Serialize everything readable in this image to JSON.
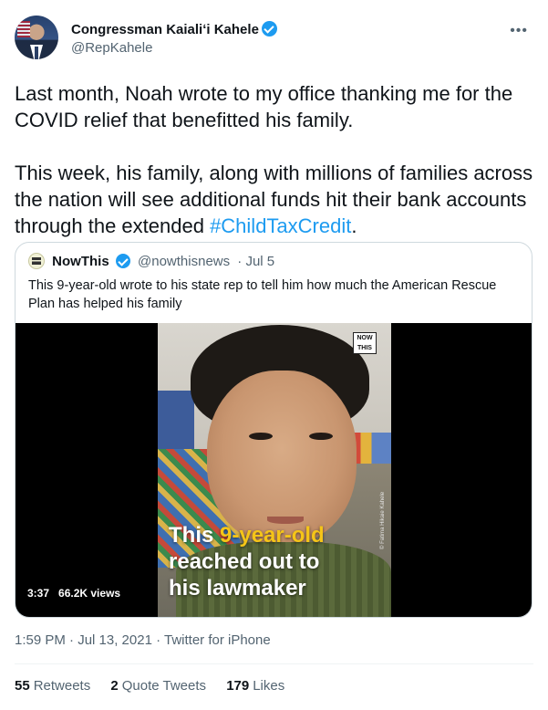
{
  "author": {
    "name": "Congressman Kaialiʻi Kahele",
    "handle": "@RepKahele",
    "verified": true
  },
  "tweet": {
    "paragraph1": "Last month, Noah wrote to my office thanking me for the COVID relief that benefitted his family.",
    "paragraph2_before": "This week, his family, along with millions of families across the nation will see additional funds hit their bank accounts through the extended ",
    "hashtag": "#ChildTaxCredit",
    "paragraph2_after": "."
  },
  "quote": {
    "name": "NowThis",
    "handle": "@nowthisnews",
    "date": "· Jul 5",
    "text": "This 9-year-old wrote to his state rep to tell him how much the American Rescue Plan has helped his family",
    "video": {
      "badge_line1": "NOW",
      "badge_line2": "THIS",
      "caption_white1": "This ",
      "caption_yellow": "9-year-old",
      "caption_line2": "reached out to",
      "caption_line3": "his lawmaker",
      "credit": "© Fatima Hikaie Kahele",
      "duration": "3:37",
      "views": "66.2K views"
    }
  },
  "meta": {
    "timestamp": "1:59 PM · Jul 13, 2021 · Twitter for iPhone"
  },
  "stats": {
    "retweets": "55",
    "retweets_label": "Retweets",
    "quote_tweets": "2",
    "quote_tweets_label": "Quote Tweets",
    "likes": "179",
    "likes_label": "Likes"
  },
  "icons": {
    "more": "more-icon",
    "verified": "verified-badge-icon"
  },
  "colors": {
    "link": "#1d9bf0",
    "secondary_text": "#536471",
    "caption_highlight": "#f5c518"
  }
}
